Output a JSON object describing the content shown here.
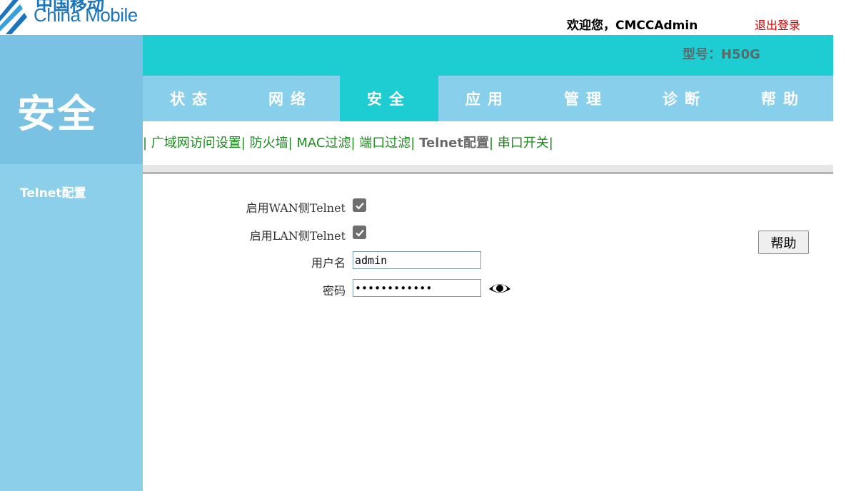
{
  "header": {
    "logo_text": "China Mobile",
    "logo_cn": "中国移动",
    "welcome": "欢迎您，CMCCAdmin",
    "logout": "退出登录",
    "model": "型号：H50G"
  },
  "section_title": "安全",
  "sidebar": {
    "items": [
      {
        "label": "Telnet配置"
      }
    ]
  },
  "nav": {
    "items": [
      {
        "label": "状态"
      },
      {
        "label": "网络"
      },
      {
        "label": "安全"
      },
      {
        "label": "应用"
      },
      {
        "label": "管理"
      },
      {
        "label": "诊断"
      },
      {
        "label": "帮助"
      }
    ],
    "active": "安全"
  },
  "subnav": {
    "items": [
      {
        "label": "广域网访问设置"
      },
      {
        "label": "防火墙"
      },
      {
        "label": "MAC过滤"
      },
      {
        "label": "端口过滤"
      },
      {
        "label": "Telnet配置"
      },
      {
        "label": "串口开关"
      }
    ],
    "current": "Telnet配置"
  },
  "form": {
    "wan_telnet_label": "启用WAN侧Telnet",
    "wan_telnet_checked": true,
    "lan_telnet_label": "启用LAN侧Telnet",
    "lan_telnet_checked": true,
    "username_label": "用户名",
    "username_value": "admin",
    "password_label": "密码",
    "password_value": "••••••••••••"
  },
  "help_button": "帮助",
  "colors": {
    "teal": "#1ecdd1",
    "light_blue": "#88cfeb",
    "link_green": "#1d8a1d",
    "logout_red": "#d00000"
  }
}
